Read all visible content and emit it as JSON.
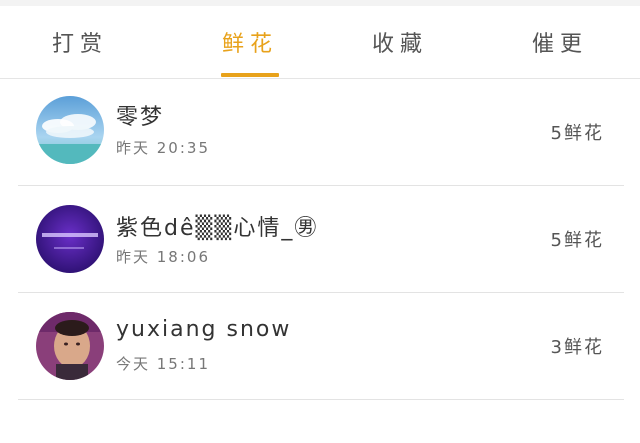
{
  "tabs": [
    {
      "label": "打赏",
      "active": false
    },
    {
      "label": "鲜花",
      "active": true
    },
    {
      "label": "收藏",
      "active": false
    },
    {
      "label": "催更",
      "active": false
    }
  ],
  "accent_color": "#e8a21b",
  "records": [
    {
      "name": "零梦",
      "time": "昨天 20:35",
      "gift": "5鲜花",
      "avatar_icon": "sky-clouds-avatar"
    },
    {
      "name": "紫色dê▒▒心情_㊚",
      "time": "昨天 18:06",
      "gift": "5鲜花",
      "avatar_icon": "purple-avatar"
    },
    {
      "name": "yuxiang snow",
      "time": "今天 15:11",
      "gift": "3鲜花",
      "avatar_icon": "portrait-avatar"
    }
  ]
}
